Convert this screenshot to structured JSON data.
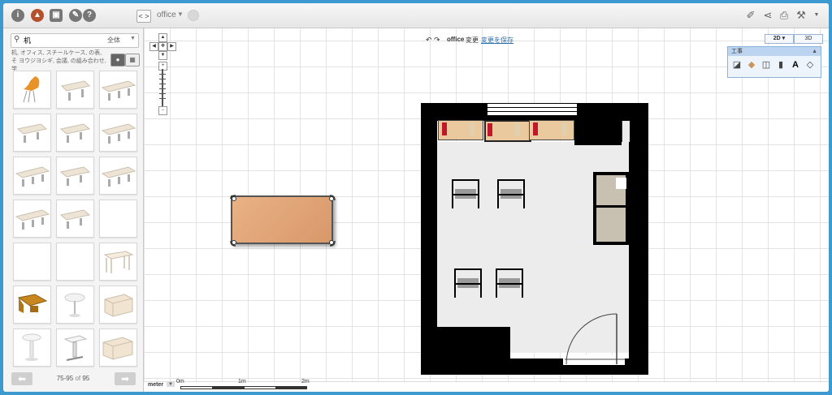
{
  "toolbar": {
    "left_icons": [
      {
        "icon": "info-icon",
        "glyph": "i"
      },
      {
        "icon": "furniture-icon",
        "glyph": "▲"
      },
      {
        "icon": "photo-icon",
        "glyph": "▣"
      },
      {
        "icon": "paint-icon",
        "glyph": "✎"
      },
      {
        "icon": "help-icon",
        "glyph": "?"
      }
    ],
    "collapse_label": "< >",
    "project_name": "office",
    "project_caret": "▼",
    "right_icons": [
      {
        "icon": "eraser-icon",
        "glyph": "✐"
      },
      {
        "icon": "share-icon",
        "glyph": "⋖"
      },
      {
        "icon": "print-icon",
        "glyph": "⎙"
      },
      {
        "icon": "wrench-icon",
        "glyph": "⚒"
      },
      {
        "icon": "menu-caret-icon",
        "glyph": "▼"
      }
    ]
  },
  "catalog": {
    "search_icon": "⚲",
    "search_value": "机",
    "category": "全体",
    "category_caret": "▼",
    "hint": "机, オフィス, スチールケース, の表, そ ヨウジヨシギ, 会議, の組み合わせ, 学",
    "view_toggle_a": "●",
    "view_toggle_b": "▦",
    "pager_prev": "⬅",
    "pager_next": "➡",
    "pager_range": "75-95",
    "pager_of": "of",
    "pager_total": "95"
  },
  "canvas": {
    "nav": {
      "up": "▲",
      "left": "◀",
      "center": "✥",
      "right": "▶",
      "down": "▼",
      "zoom_in": "+",
      "zoom_out": "−"
    },
    "undo": "↶",
    "redo": "↷",
    "project_name": "office",
    "changed": "変更",
    "save_link": "変更を保存",
    "view_2d": "2D ▾",
    "view_3d": "3D",
    "construct_title": "工事",
    "construct_close": "▲",
    "construct_tools": [
      {
        "icon": "wall-tool-icon",
        "glyph": "◪"
      },
      {
        "icon": "floor-tool-icon",
        "glyph": "◆"
      },
      {
        "icon": "door-tool-icon",
        "glyph": "◫"
      },
      {
        "icon": "window-tool-icon",
        "glyph": "▮"
      },
      {
        "icon": "text-tool-icon",
        "glyph": "A"
      },
      {
        "icon": "dimension-tool-icon",
        "glyph": "◇"
      }
    ],
    "units": "meter",
    "units_caret": "▼",
    "scale_labels": [
      "0m",
      "1m",
      "2m"
    ]
  },
  "colors": {
    "frame": "#3d9ad1",
    "table_top": "#e2a878",
    "shelf": "#e9c99d",
    "book": "#c0182a",
    "link": "#2a6fb0",
    "construct_panel": "#bcd4ef"
  }
}
